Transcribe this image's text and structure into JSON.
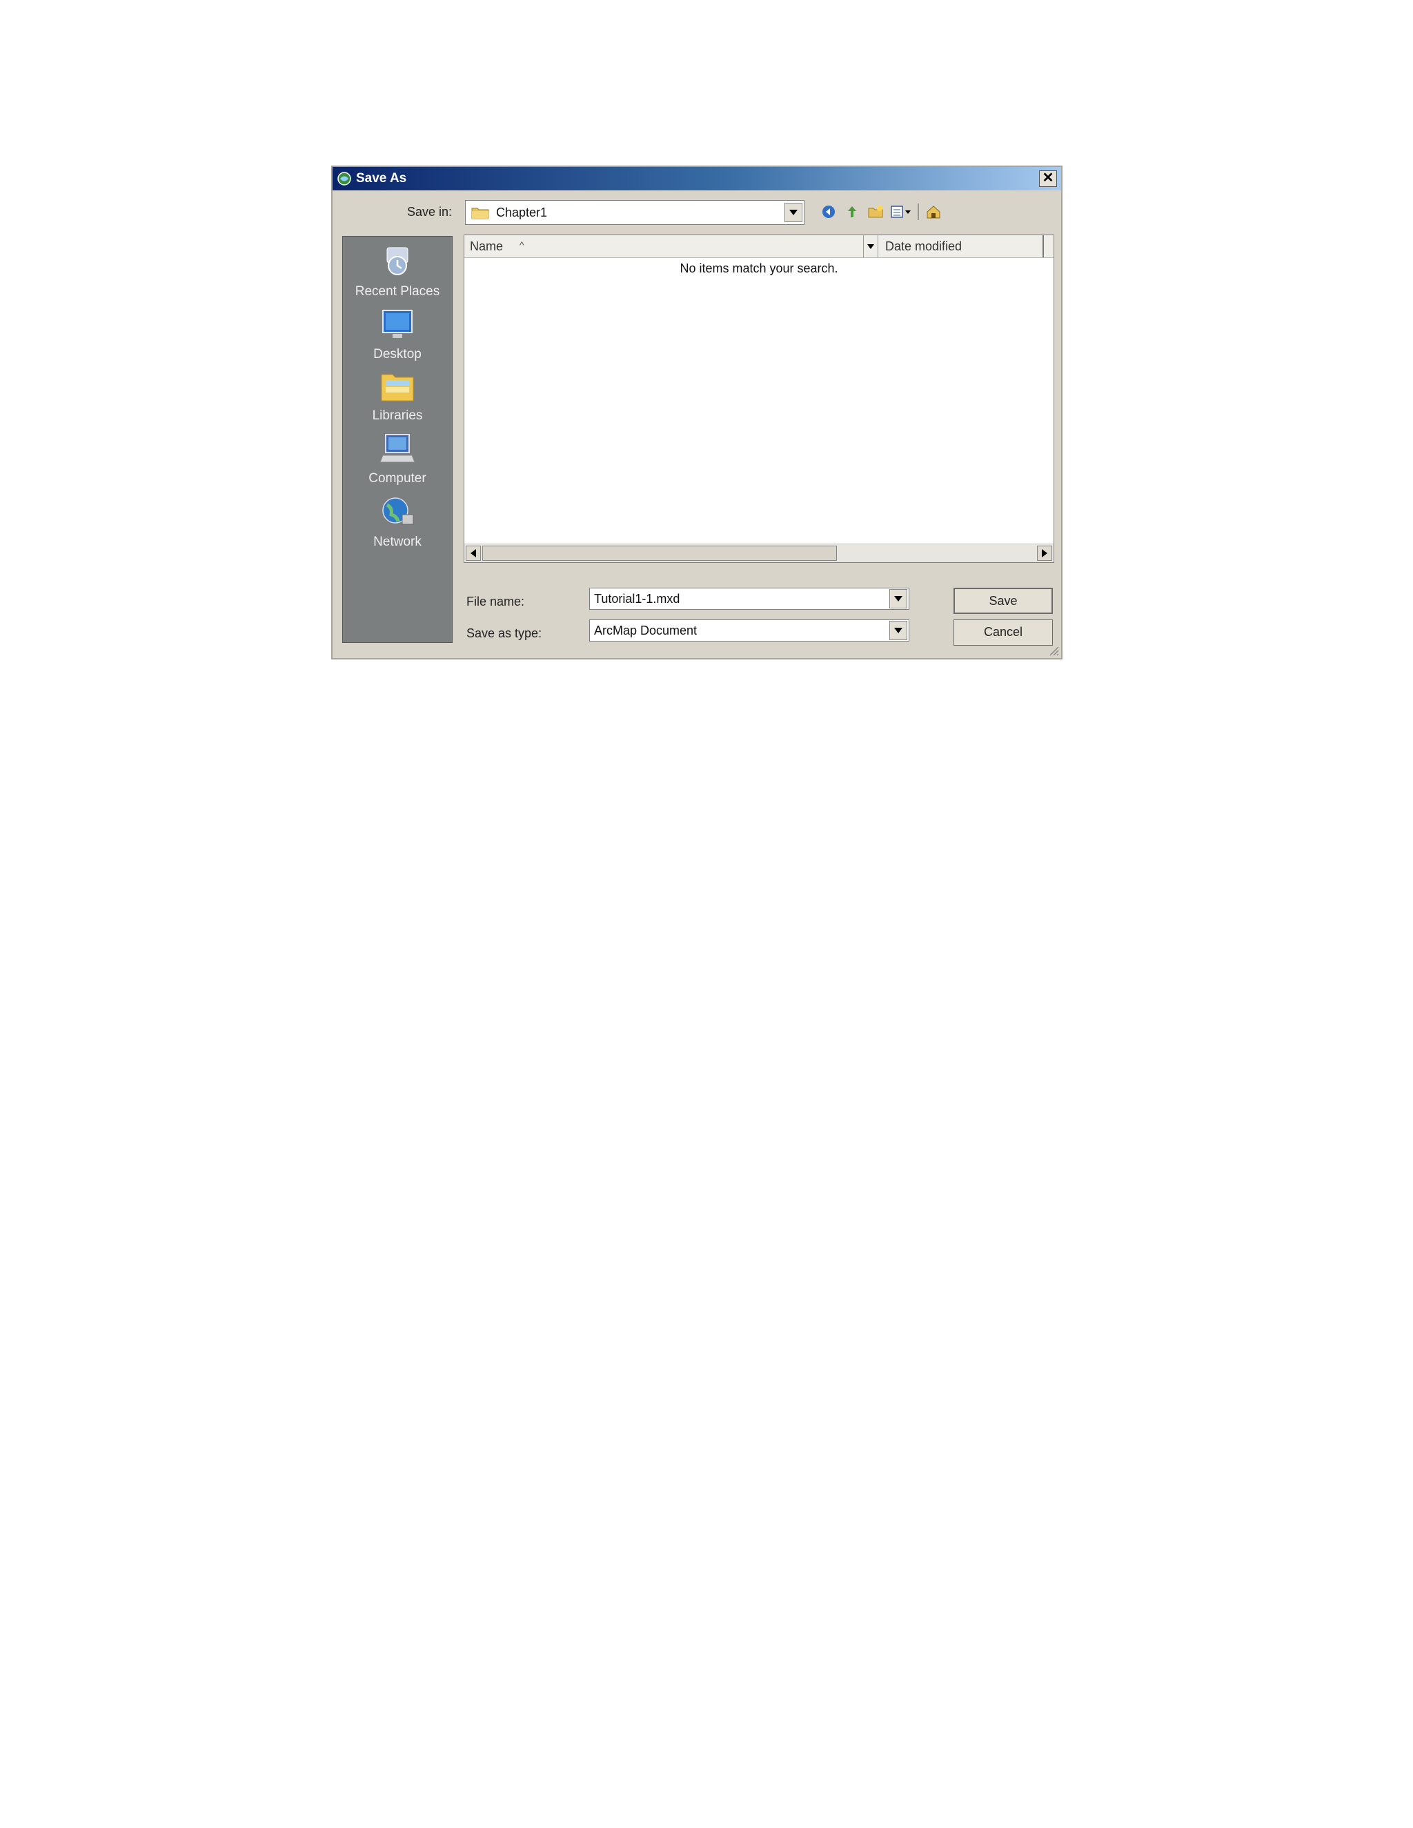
{
  "dialog": {
    "title": "Save As",
    "close_label": "✕"
  },
  "save_in": {
    "label": "Save in:",
    "value": "Chapter1"
  },
  "toolbar": {
    "icons": [
      "back-icon",
      "up-folder-icon",
      "new-folder-icon",
      "view-menu-icon",
      "arcgis-home-icon"
    ]
  },
  "places": [
    {
      "label": "Recent Places",
      "icon": "recent-places-icon"
    },
    {
      "label": "Desktop",
      "icon": "desktop-icon"
    },
    {
      "label": "Libraries",
      "icon": "libraries-icon"
    },
    {
      "label": "Computer",
      "icon": "computer-icon"
    },
    {
      "label": "Network",
      "icon": "network-icon"
    }
  ],
  "file_list": {
    "columns": {
      "name": "Name",
      "sort_indicator": "^",
      "date": "Date modified"
    },
    "empty_message": "No items match your search."
  },
  "file_name": {
    "label": "File name:",
    "value": "Tutorial1-1.mxd"
  },
  "save_type": {
    "label": "Save as type:",
    "value": "ArcMap Document"
  },
  "buttons": {
    "save": "Save",
    "cancel": "Cancel"
  },
  "colors": {
    "title_gradient_start": "#0a246a",
    "title_gradient_end": "#a6caf0",
    "places_bar": "#7c7f80",
    "dialog_face": "#d8d4ca"
  }
}
